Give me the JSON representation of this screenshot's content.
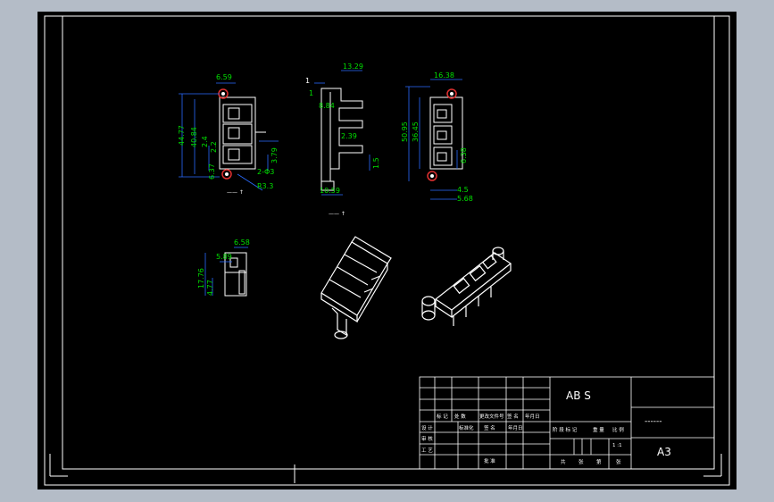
{
  "drawing": {
    "material": "AB S",
    "sheet_size": "A3",
    "dash_text": "------",
    "view_labels": {
      "front": "—— ↑",
      "side": "—— ↑"
    },
    "side_view_top_label": "1",
    "scale_text": "1 :1",
    "dimensions": {
      "front": [
        "6.59",
        "44.77",
        "40.84",
        "2.4",
        "2.2",
        "6.37",
        "2-Φ3",
        "3.79",
        "R3.3"
      ],
      "side": [
        "13.29",
        "8.84",
        "2.39",
        "1.5",
        "10.59",
        "1"
      ],
      "right": [
        "16.38",
        "50.95",
        "36.45",
        "6.38",
        "4.5",
        "5.68"
      ],
      "detail": [
        "6.58",
        "5.89",
        "17.76",
        "4.77"
      ]
    },
    "title_block": {
      "header_labels": [
        "标 记",
        "处 数",
        "更改文件号",
        "签 名",
        "年月日"
      ],
      "row_labels_1": [
        "设 计",
        "标准化",
        "签 名",
        "年月日"
      ],
      "stage_labels": [
        "阶 段 标 记",
        "重 量",
        "比 例"
      ],
      "row_labels_2": [
        "审 核",
        "工 艺",
        "批 准"
      ],
      "bottom_labels": [
        "共",
        "张",
        "第",
        "张"
      ]
    }
  }
}
